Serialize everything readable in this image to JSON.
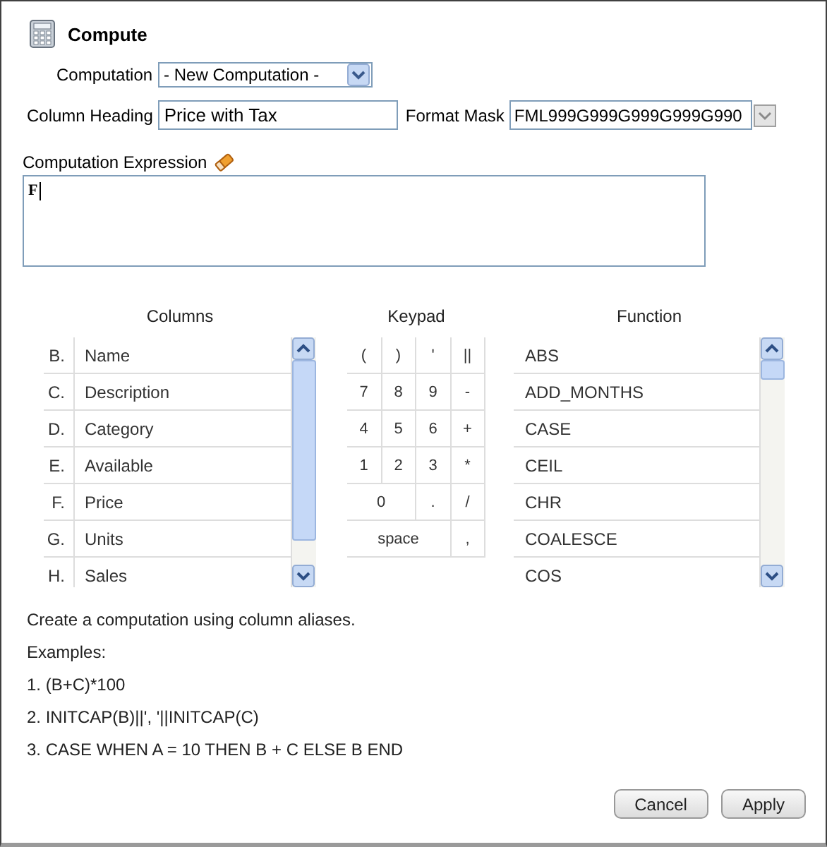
{
  "title": "Compute",
  "computation": {
    "label": "Computation",
    "value": "- New Computation -"
  },
  "column_heading": {
    "label": "Column Heading",
    "value": "Price with Tax"
  },
  "format_mask": {
    "label": "Format Mask",
    "value": "FML999G999G999G999G990"
  },
  "expression": {
    "label": "Computation Expression",
    "value": "F"
  },
  "columns": {
    "heading": "Columns",
    "items": [
      {
        "alias": "B.",
        "name": "Name"
      },
      {
        "alias": "C.",
        "name": "Description"
      },
      {
        "alias": "D.",
        "name": "Category"
      },
      {
        "alias": "E.",
        "name": "Available"
      },
      {
        "alias": "F.",
        "name": "Price"
      },
      {
        "alias": "G.",
        "name": "Units"
      },
      {
        "alias": "H.",
        "name": "Sales"
      }
    ]
  },
  "keypad": {
    "heading": "Keypad",
    "keys": [
      {
        "label": "(",
        "kind": "key"
      },
      {
        "label": ")",
        "kind": "key"
      },
      {
        "label": "'",
        "kind": "key"
      },
      {
        "label": "||",
        "kind": "key"
      },
      {
        "label": "7",
        "kind": "key"
      },
      {
        "label": "8",
        "kind": "key"
      },
      {
        "label": "9",
        "kind": "key"
      },
      {
        "label": "-",
        "kind": "key"
      },
      {
        "label": "4",
        "kind": "key"
      },
      {
        "label": "5",
        "kind": "key"
      },
      {
        "label": "6",
        "kind": "key"
      },
      {
        "label": "+",
        "kind": "key"
      },
      {
        "label": "1",
        "kind": "key"
      },
      {
        "label": "2",
        "kind": "key"
      },
      {
        "label": "3",
        "kind": "key"
      },
      {
        "label": "*",
        "kind": "key"
      },
      {
        "label": "0",
        "kind": "zero"
      },
      {
        "label": ".",
        "kind": "key"
      },
      {
        "label": "/",
        "kind": "key"
      },
      {
        "label": "space",
        "kind": "spacebar"
      },
      {
        "label": ",",
        "kind": "key"
      }
    ]
  },
  "functions": {
    "heading": "Function",
    "items": [
      "ABS",
      "ADD_MONTHS",
      "CASE",
      "CEIL",
      "CHR",
      "COALESCE",
      "COS"
    ]
  },
  "help": [
    "Create a computation using column aliases.",
    "Examples:",
    "1. (B+C)*100",
    "2. INITCAP(B)||', '||INITCAP(C)",
    "3. CASE WHEN A = 10 THEN B + C ELSE B END"
  ],
  "buttons": [
    "Cancel",
    "Apply"
  ]
}
